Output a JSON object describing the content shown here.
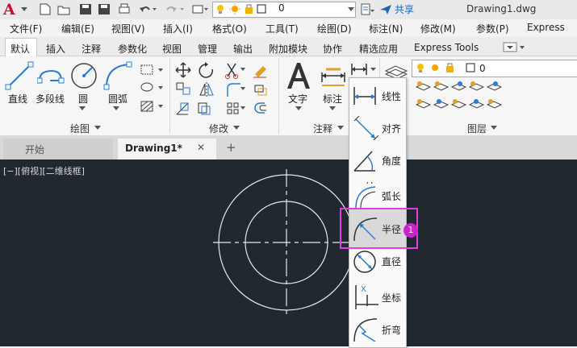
{
  "titlebar": {
    "layer_value": "0",
    "share_label": "共享",
    "doc_title": "Drawing1.dwg"
  },
  "menubar": {
    "items": [
      "文件(F)",
      "编辑(E)",
      "视图(V)",
      "插入(I)",
      "格式(O)",
      "工具(T)",
      "绘图(D)",
      "标注(N)",
      "修改(M)",
      "参数(P)",
      "Express"
    ]
  },
  "ribbon_tabs": {
    "items": [
      "默认",
      "插入",
      "注释",
      "参数化",
      "视图",
      "管理",
      "输出",
      "附加模块",
      "协作",
      "精选应用",
      "Express Tools"
    ],
    "active": "默认"
  },
  "ribbon": {
    "draw": {
      "line": "直线",
      "polyline": "多段线",
      "circle": "圆",
      "arc": "圆弧",
      "panel": "绘图"
    },
    "modify": {
      "panel": "修改"
    },
    "annotation": {
      "text": "文字",
      "dimension": "标注",
      "panel": "注释"
    },
    "layers": {
      "layer_value": "0",
      "panel": "图层"
    }
  },
  "file_tabs": {
    "start": "开始",
    "drawing": "Drawing1*",
    "close": "✕",
    "add": "+"
  },
  "canvas": {
    "view_label": "[−][俯视][二维线框]"
  },
  "dim_dropdown": {
    "items": [
      "线性",
      "对齐",
      "角度",
      "弧长",
      "半径",
      "直径",
      "坐标",
      "折弯"
    ],
    "highlighted": "半径",
    "badge": "1"
  },
  "colors": {
    "accent": "#e040e0",
    "canvas_bg": "#212830",
    "share_blue": "#1e63b8"
  }
}
